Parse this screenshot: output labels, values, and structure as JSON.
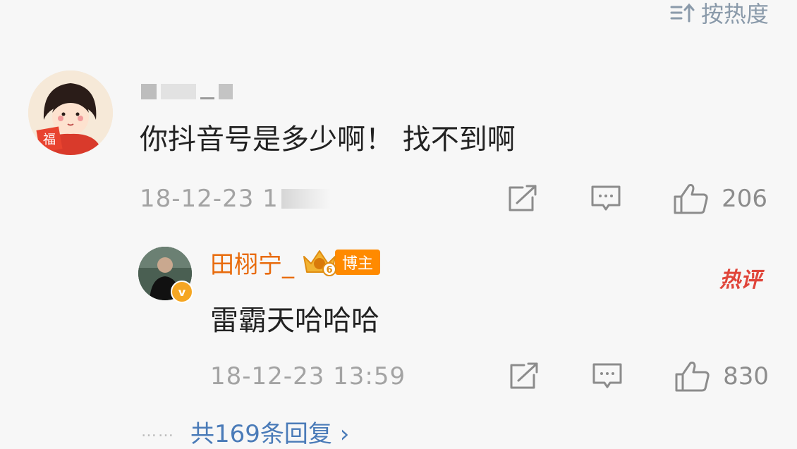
{
  "sort": {
    "label": "按热度",
    "icon": "sort-icon"
  },
  "comment": {
    "text": "你抖音号是多少啊！ 找不到啊",
    "timestamp_visible": "18-12-23 1",
    "likes": "206",
    "avatar_icon": "avatar-girl-fu",
    "avatar_char": "福"
  },
  "reply": {
    "author": "田栩宁_",
    "level": "6",
    "tag": "博主",
    "verified_mark": "v",
    "text": "雷霸天哈哈哈",
    "hot_label": "热评",
    "timestamp": "18-12-23 13:59",
    "likes": "830"
  },
  "more_replies": {
    "dots": "……",
    "label": "共169条回复",
    "chevron": "›"
  },
  "colors": {
    "accent_name": "#e86b0c",
    "tag_bg": "#ff8a00",
    "link": "#4a7bb8",
    "hot": "#e0453a",
    "muted": "#a3a3a3"
  }
}
